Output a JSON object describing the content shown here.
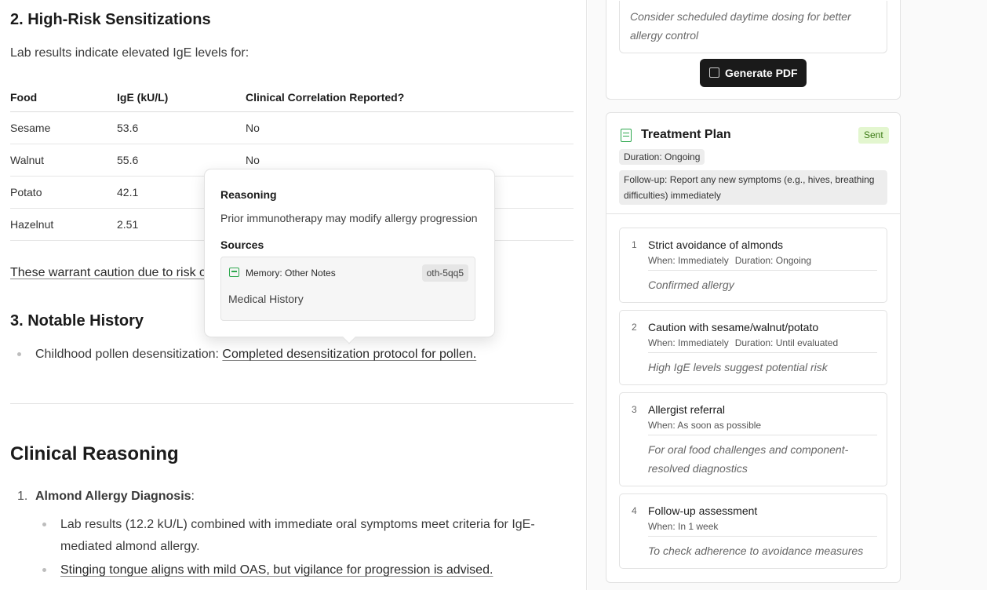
{
  "document": {
    "section2_title": "2. High-Risk Sensitizations",
    "section2_intro": "Lab results indicate elevated IgE levels for:",
    "table": {
      "headers": [
        "Food",
        "IgE (kU/L)",
        "Clinical Correlation Reported?"
      ],
      "rows": [
        [
          "Sesame",
          "53.6",
          "No"
        ],
        [
          "Walnut",
          "55.6",
          "No"
        ],
        [
          "Potato",
          "42.1",
          ""
        ],
        [
          "Hazelnut",
          "2.51",
          ""
        ]
      ]
    },
    "caution_text": "These warrant caution due to risk o",
    "section3_title": "3. Notable History",
    "history_item_prefix": "Childhood pollen desensitization: ",
    "history_item_link": "Completed desensitization protocol for pollen.",
    "reasoning_title": "Clinical Reasoning",
    "reasoning_item_num": "1.",
    "reasoning_item_title": "Almond Allergy Diagnosis",
    "reasoning_item_colon": ":",
    "reasoning_bullet1": "Lab results (12.2 kU/L) combined with immediate oral symptoms meet criteria for IgE-mediated almond allergy.",
    "reasoning_bullet2": "Stinging tongue aligns with mild OAS, but vigilance for progression is advised."
  },
  "popover": {
    "reasoning_label": "Reasoning",
    "reasoning_text": "Prior immunotherapy may modify allergy progression",
    "sources_label": "Sources",
    "source": {
      "label": "Memory: Other Notes",
      "id": "oth-5qq5",
      "subtitle": "Medical History",
      "icon": "folder-icon"
    }
  },
  "panel": {
    "note_text": "Consider scheduled daytime dosing for better allergy control",
    "pdf_button": "Generate PDF",
    "plan_title": "Treatment Plan",
    "plan_status": "Sent",
    "duration_chip": "Duration: Ongoing",
    "followup_chip": "Follow-up: Report any new symptoms (e.g., hives, breathing difficulties) immediately",
    "steps": [
      {
        "num": "1",
        "title": "Strict avoidance of almonds",
        "when": "When: Immediately",
        "duration": "Duration: Ongoing",
        "note": "Confirmed allergy"
      },
      {
        "num": "2",
        "title": "Caution with sesame/walnut/potato",
        "when": "When: Immediately",
        "duration": "Duration: Until evaluated",
        "note": "High IgE levels suggest potential risk"
      },
      {
        "num": "3",
        "title": "Allergist referral",
        "when": "When: As soon as possible",
        "duration": "",
        "note": "For oral food challenges and component-resolved diagnostics"
      },
      {
        "num": "4",
        "title": "Follow-up assessment",
        "when": "When: In 1 week",
        "duration": "",
        "note": "To check adherence to avoidance measures"
      }
    ]
  },
  "colors": {
    "accent_green": "#2fa84f",
    "sent_badge_bg": "#e3f6cf",
    "button_dark": "#1a1a1a"
  }
}
